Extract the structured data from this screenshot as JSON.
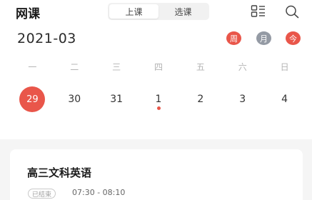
{
  "header": {
    "title": "网课",
    "tabs": [
      {
        "label": "上课",
        "active": true
      },
      {
        "label": "选课",
        "active": false
      }
    ],
    "icons": [
      "list-view-icon",
      "search-icon"
    ]
  },
  "calendar": {
    "month": "2021-03",
    "view_buttons": [
      {
        "label": "周",
        "color": "#e9564a"
      },
      {
        "label": "月",
        "color": "#949aa4"
      },
      {
        "label": "今",
        "color": "#e9564a"
      }
    ],
    "weekdays": [
      "一",
      "二",
      "三",
      "四",
      "五",
      "六",
      "日"
    ],
    "days": [
      {
        "label": "29",
        "selected": true,
        "has_class": false
      },
      {
        "label": "30",
        "selected": false,
        "has_class": false
      },
      {
        "label": "31",
        "selected": false,
        "has_class": false
      },
      {
        "label": "1",
        "selected": false,
        "has_class": true
      },
      {
        "label": "2",
        "selected": false,
        "has_class": false
      },
      {
        "label": "3",
        "selected": false,
        "has_class": false
      },
      {
        "label": "4",
        "selected": false,
        "has_class": false
      }
    ]
  },
  "course": {
    "title": "高三文科英语",
    "status": "已结束",
    "time": "07:30 - 08:10"
  },
  "colors": {
    "accent": "#e9564a",
    "muted": "#949aa4"
  }
}
